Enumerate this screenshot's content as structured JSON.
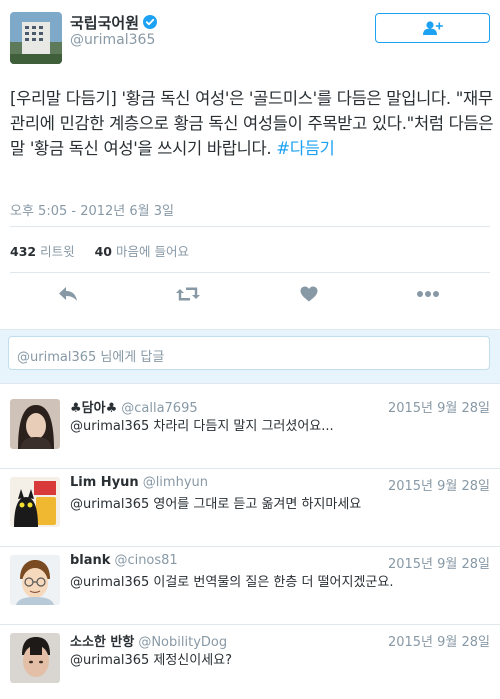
{
  "tweet": {
    "display_name": "국립국어원",
    "handle": "@urimal365",
    "text_main": "[우리말 다듬기] '황금 독신 여성'은 '골드미스'를 다듬은 말입니다. \"재무 관리에 민감한 계층으로 황금 독신 여성들이 주목받고 있다.\"처럼 다듬은 말 '황금 독신 여성'을 쓰시기 바랍니다. ",
    "hashtag": "#다듬기",
    "timestamp": "오후 5:05 - 2012년 6월 3일",
    "retweets_count": "432",
    "retweets_label": "리트윗",
    "likes_count": "40",
    "likes_label": "마음에 들어요"
  },
  "reply_box": {
    "placeholder": "@urimal365 님에게 답글"
  },
  "replies": [
    {
      "name": "♣담아♣",
      "handle": "@calla7695",
      "date": "2015년 9월 28일",
      "text": "@urimal365 차라리 다듬지 말지 그러셨어요..."
    },
    {
      "name": "Lim Hyun",
      "handle": "@limhyun",
      "date": "2015년 9월 28일",
      "text": "@urimal365 영어를 그대로 듣고 옮겨면 하지마세요"
    },
    {
      "name": "blank",
      "handle": "@cinos81",
      "date": "2015년 9월 28일",
      "text": "@urimal365 이걸로 번역물의 질은 한층 더 떨어지겠군요."
    },
    {
      "name": "소소한 반항",
      "handle": "@NobilityDog",
      "date": "2015년 9월 28일",
      "text": "@urimal365 제정신이세요?"
    }
  ],
  "colors": {
    "accent": "#1da1f2",
    "muted": "#8899a6",
    "text": "#292f33"
  }
}
